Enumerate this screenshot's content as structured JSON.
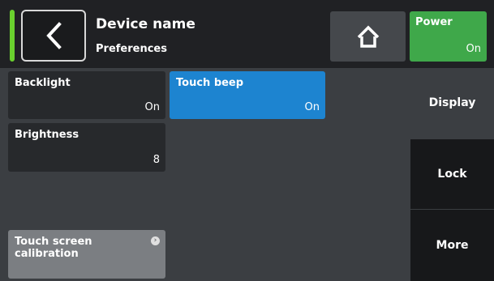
{
  "header": {
    "title": "Device name",
    "subtitle": "Preferences",
    "power": {
      "label": "Power",
      "value": "On",
      "color": "#3fa84a"
    },
    "status_led_color": "#6ad12e",
    "icons": {
      "back": "chevron-left-icon",
      "home": "home-icon"
    }
  },
  "tiles": {
    "backlight": {
      "label": "Backlight",
      "value": "On"
    },
    "touch_beep": {
      "label": "Touch beep",
      "value": "On",
      "color": "#1d84d0"
    },
    "brightness": {
      "label": "Brightness",
      "value": "8"
    },
    "calibration": {
      "label_line1": "Touch screen",
      "label_line2": "calibration",
      "icon": "arrow-right-circle-icon"
    }
  },
  "side_menu": {
    "items": [
      {
        "label": "Display",
        "selected": true
      },
      {
        "label": "Lock",
        "selected": false
      },
      {
        "label": "More",
        "selected": false
      }
    ]
  }
}
